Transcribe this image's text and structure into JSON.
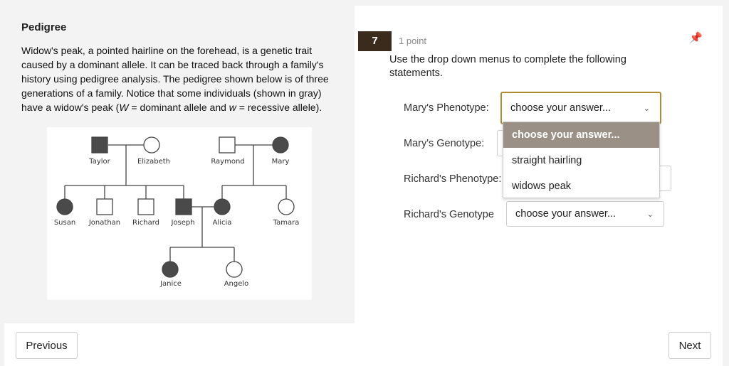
{
  "passage": {
    "title": "Pedigree",
    "text": "Widow's peak, a pointed hairline on the forehead, is a genetic trait caused by a dominant allele. It can be traced back through a family's history using pedigree analysis. The pedigree shown below is of three generations of a family. Notice that some individuals (shown in gray) have a widow's peak (",
    "w_upper": "W",
    "mid": " = dominant allele and ",
    "w_lower": "w",
    "end": " = recessive allele)."
  },
  "pedigree": {
    "gen1": [
      "Taylor",
      "Elizabeth",
      "Raymond",
      "Mary"
    ],
    "gen2": [
      "Susan",
      "Jonathan",
      "Richard",
      "Joseph",
      "Alicia",
      "Tamara"
    ],
    "gen3": [
      "Janice",
      "Angelo"
    ],
    "affected_color": "#4a4a4a"
  },
  "question": {
    "number": "7",
    "points": "1 point",
    "pin_icon": "pin-icon",
    "instructions": "Use the drop down menus to complete the following statements.",
    "accent_color": "#b08a2e",
    "rows": [
      {
        "label": "Mary's Phenotype:",
        "value": "choose your answer..."
      },
      {
        "label": "Mary's Genotype:",
        "value": ""
      },
      {
        "label": "Richard's Phenotype:",
        "value": ""
      },
      {
        "label": "Richard's Genotype",
        "value": "choose your answer..."
      }
    ],
    "open_menu": {
      "options": [
        "choose your answer...",
        "straight hairling",
        "widows peak"
      ],
      "highlighted": 0
    }
  },
  "nav": {
    "previous": "Previous",
    "next": "Next"
  }
}
